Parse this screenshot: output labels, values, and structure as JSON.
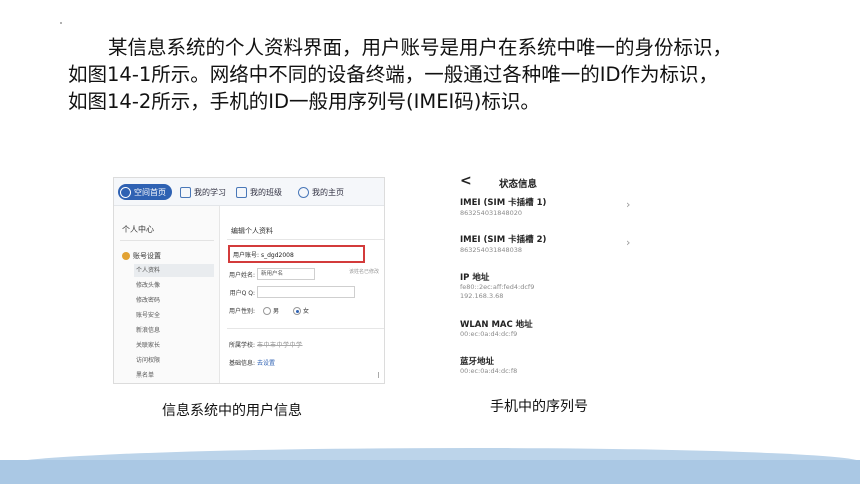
{
  "paragraph": {
    "line1": "某信息系统的个人资料界面，用户账号是用户在系统中唯一的身份标识，",
    "line2": "如图14-1所示。网络中不同的设备终端，一般通过各种唯一的ID作为标识，",
    "line3": "如图14-2所示，手机的ID一般用序列号(IMEI码)标识。"
  },
  "left_screenshot": {
    "tabs": [
      "空间首页",
      "我的学习",
      "我的班级",
      "我的主页"
    ],
    "sidebar_heading": "个人中心",
    "sidebar_parent": "账号设置",
    "sidebar_items": [
      "个人资料",
      "修改头像",
      "修改密码",
      "账号安全",
      "新浪信息",
      "关联家长",
      "访问权限",
      "黑名单"
    ],
    "main_title": "编辑个人资料",
    "fields": {
      "account_label": "用户账号:",
      "account_value": "s_dgd2008",
      "name_label": "用户姓名:",
      "name_value": "新用户名",
      "name_note": "该姓名已修改",
      "qq_label": "用户Q Q:",
      "gender_label": "用户性别:",
      "gender_male": "男",
      "gender_female": "女",
      "school_label": "所属学校:",
      "school_value": "市中市中学中学",
      "extra_label": "基础信息:",
      "extra_value": "去设置"
    }
  },
  "right_screenshot": {
    "back": "<",
    "title": "状态信息",
    "items": [
      {
        "label": "IMEI (SIM 卡插槽 1)",
        "value": "863254031848020",
        "arrow": "›"
      },
      {
        "label": "IMEI (SIM 卡插槽 2)",
        "value": "863254031848038",
        "arrow": "›"
      },
      {
        "label": "IP 地址",
        "value": "fe80::2ec:aff:fed4:dcf9",
        "value2": "192.168.3.68"
      },
      {
        "label": "WLAN MAC 地址",
        "value": "00:ec:0a:d4:dc:f9"
      },
      {
        "label": "蓝牙地址",
        "value": "00:ec:0a:d4:dc:f8"
      }
    ]
  },
  "captions": {
    "left": "信息系统中的用户信息",
    "right": "手机中的序列号"
  }
}
